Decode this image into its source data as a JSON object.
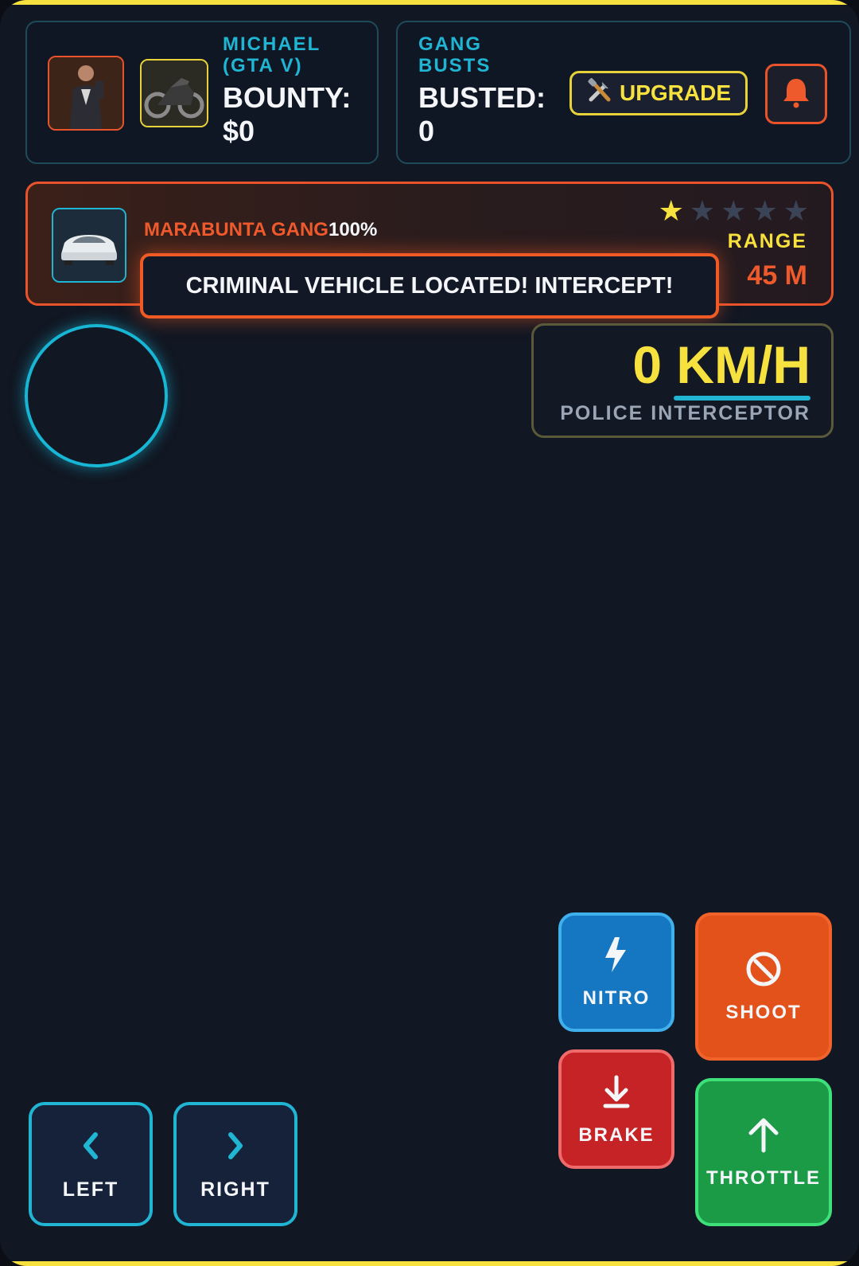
{
  "colors": {
    "accent_yellow": "#f7e13e",
    "accent_cyan": "#1fb5d3",
    "accent_orange": "#e8532b",
    "background": "#111723"
  },
  "player": {
    "name": "MICHAEL (GTA V)",
    "bounty_text": "BOUNTY: $0",
    "character_icon": "character-portrait",
    "vehicle_icon": "motorcycle"
  },
  "gang_panel": {
    "title": "GANG BUSTS",
    "busted_text": "BUSTED: 0",
    "upgrade_label": "UPGRADE",
    "upgrade_icon": "tools-icon",
    "bell_icon": "bell-icon"
  },
  "target": {
    "gang_name": "MARABUNTA GANG",
    "health": "100%",
    "wanted_level": 1,
    "wanted_max": 5,
    "range_label": "RANGE",
    "range_value": "45 M",
    "vehicle_icon": "car"
  },
  "alert": {
    "message": "CRIMINAL VEHICLE LOCATED! INTERCEPT!"
  },
  "speedometer": {
    "speed": "0 KM/H",
    "vehicle_name": "POLICE INTERCEPTOR"
  },
  "controls": {
    "left": "LEFT",
    "right": "RIGHT",
    "nitro": "NITRO",
    "brake": "BRAKE",
    "shoot": "SHOOT",
    "throttle": "THROTTLE"
  }
}
